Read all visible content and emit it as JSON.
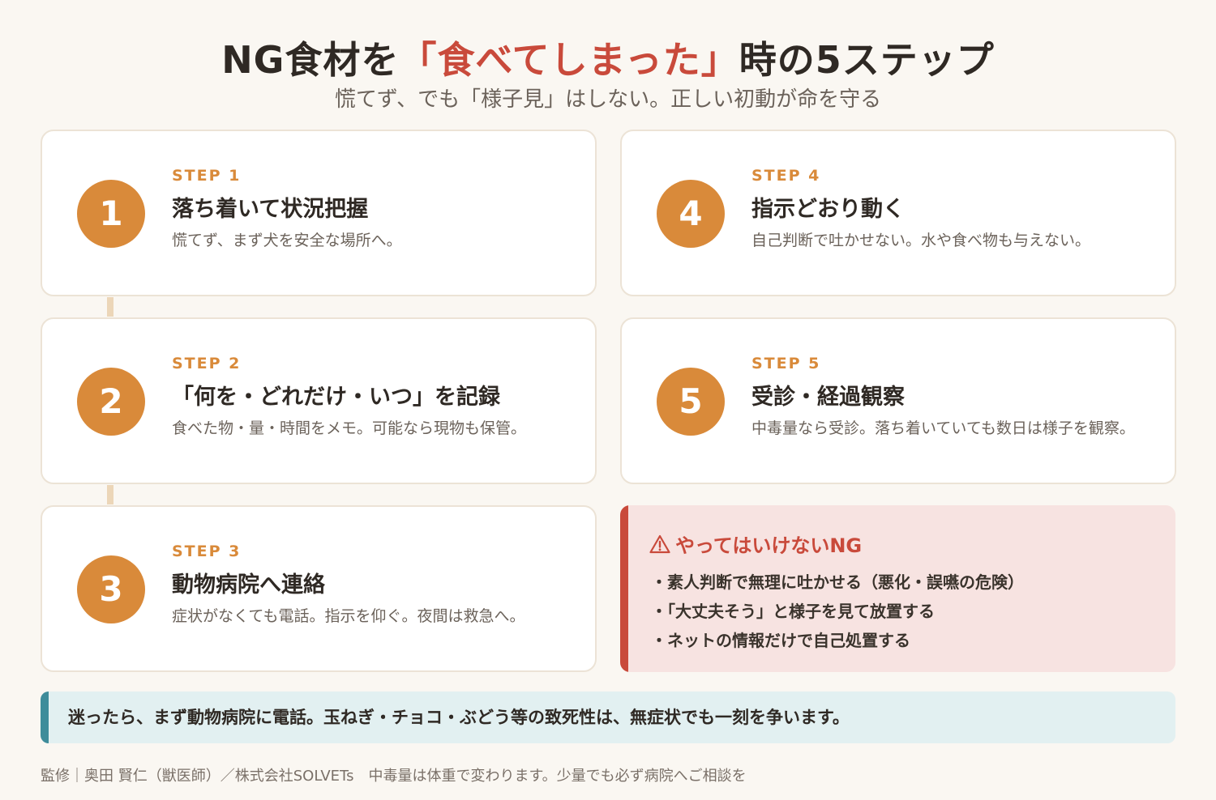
{
  "header": {
    "title_prefix": "NG食材を",
    "title_highlight": "「食べてしまった」",
    "title_suffix": "時の5ステップ",
    "subtitle": "慌てず、でも「様子見」はしない。正しい初動が命を守る"
  },
  "steps": [
    {
      "number": "1",
      "tag": "STEP 1",
      "title": "落ち着いて状況把握",
      "desc": "慌てず、まず犬を安全な場所へ。"
    },
    {
      "number": "2",
      "tag": "STEP 2",
      "title": "「何を・どれだけ・いつ」を記録",
      "desc": "食べた物・量・時間をメモ。可能なら現物も保管。"
    },
    {
      "number": "3",
      "tag": "STEP 3",
      "title": "動物病院へ連絡",
      "desc": "症状がなくても電話。指示を仰ぐ。夜間は救急へ。"
    },
    {
      "number": "4",
      "tag": "STEP 4",
      "title": "指示どおり動く",
      "desc": "自己判断で吐かせない。水や食べ物も与えない。"
    },
    {
      "number": "5",
      "tag": "STEP 5",
      "title": "受診・経過観察",
      "desc": "中毒量なら受診。落ち着いていても数日は様子を観察。"
    }
  ],
  "ng_box": {
    "icon": "warning-icon",
    "title": "やってはいけないNG",
    "items": [
      "・素人判断で無理に吐かせる（悪化・誤嚥の危険）",
      "・「大丈夫そう」と様子を見て放置する",
      "・ネットの情報だけで自己処置する"
    ]
  },
  "notice": {
    "text": "迷ったら、まず動物病院に電話。玉ねぎ・チョコ・ぶどう等の致死性は、無症状でも一刻を争います。"
  },
  "footer": {
    "text": "監修｜奥田 賢仁（獣医師）／株式会社SOLVETs　中毒量は体重で変わります。少量でも必ず病院へご相談を"
  },
  "colors": {
    "accent_orange": "#d98a3a",
    "highlight_red": "#c94a3b",
    "ng_background": "#f7e3e1",
    "notice_background": "#e2f0f1",
    "notice_bar": "#3e8c9a"
  }
}
